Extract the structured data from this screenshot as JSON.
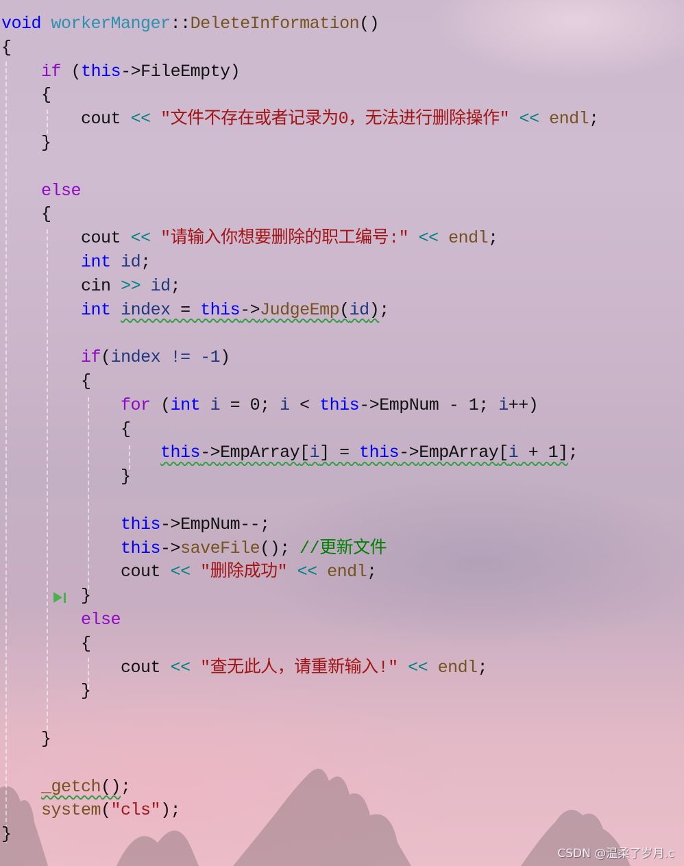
{
  "editor": {
    "function_signature": {
      "return_type": "void",
      "class_name": "workerManger",
      "scope_op": "::",
      "function_name": "DeleteInformation",
      "parens": "()"
    },
    "lines": {
      "open_brace": "{",
      "close_brace": "}",
      "if_kw": "if",
      "else_kw": "else",
      "for_kw": "for",
      "int_kw": "int",
      "this_kw": "this",
      "arrow": "->",
      "cout": "cout",
      "cin": "cin",
      "shift_left": "<<",
      "shift_right": ">>",
      "endl": "endl",
      "semicolon": ";",
      "file_empty": "FileEmpty",
      "msg_file_empty": "\"文件不存在或者记录为0，无法进行删除操作\"",
      "msg_enter_id": "\"请输入你想要删除的职工编号:\"",
      "var_id": "id",
      "var_index": "index",
      "var_i": "i",
      "judge_emp": "JudgeEmp",
      "cond_index": "index != -1",
      "emp_num": "EmpNum",
      "emp_array": "EmpArray",
      "emp_num_dec": "EmpNum--",
      "save_file": "saveFile",
      "comment_update": "//更新文件",
      "msg_delete_ok": "\"删除成功\"",
      "msg_not_found": "\"查无此人，请重新输入!\"",
      "getch": "_getch",
      "system": "system",
      "cls_arg": "\"cls\""
    },
    "step_icon": "step-over-icon"
  },
  "watermark": "CSDN @温柔了岁月.c"
}
